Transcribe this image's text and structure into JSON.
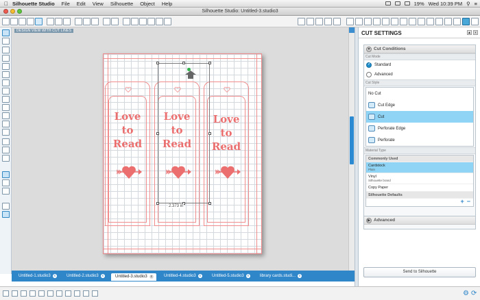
{
  "menubar": {
    "app_name": "Silhouette Studio",
    "menus": [
      "File",
      "Edit",
      "View",
      "Silhouette",
      "Object",
      "Help"
    ],
    "battery": "19%",
    "clock": "Wed 10:39 PM"
  },
  "window": {
    "title": "Silhouette Studio: Untitled-3.studio3"
  },
  "canvas": {
    "design_label": "DESIGN VIEW WITH CUT LINES",
    "dimension_label": "2.373 in",
    "tags": [
      {
        "line1": "Love",
        "line2": "to",
        "line3": "Read"
      },
      {
        "line1": "Love",
        "line2": "to",
        "line3": "Read"
      },
      {
        "line1": "Love",
        "line2": "to",
        "line3": "Read"
      }
    ]
  },
  "tabs": [
    {
      "label": "Untitled-1.studio3",
      "active": false
    },
    {
      "label": "Untitled-2.studio3",
      "active": false
    },
    {
      "label": "Untitled-3.studio3",
      "active": true
    },
    {
      "label": "Untitled-4.studio3",
      "active": false
    },
    {
      "label": "Untitled-5.studio3",
      "active": false
    },
    {
      "label": "library cards.studi...",
      "active": false
    }
  ],
  "panel": {
    "title": "CUT SETTINGS",
    "cut_conditions": "Cut Conditions",
    "cut_mode_label": "Cut Mode",
    "modes": [
      "Standard",
      "Advanced"
    ],
    "selected_mode": "Standard",
    "cut_style_label": "Cut Style",
    "styles": [
      "No Cut",
      "Cut Edge",
      "Cut",
      "Perforate Edge",
      "Perforate"
    ],
    "selected_style": "Cut",
    "material_type_label": "Material Type",
    "materials": {
      "group1": "Commonly Used",
      "selected_name": "Cardstock",
      "selected_sub": "Plain",
      "vinyl_name": "Vinyl",
      "vinyl_sub": "Silhouette brand",
      "copy_paper": "Copy Paper",
      "group2": "Silhouette Defaults"
    },
    "advanced": "Advanced",
    "send_button": "Send to Silhouette"
  },
  "colors": {
    "accent": "#2f86c9",
    "cut_line": "#f08c8c",
    "selection": "#8fd4f4"
  }
}
